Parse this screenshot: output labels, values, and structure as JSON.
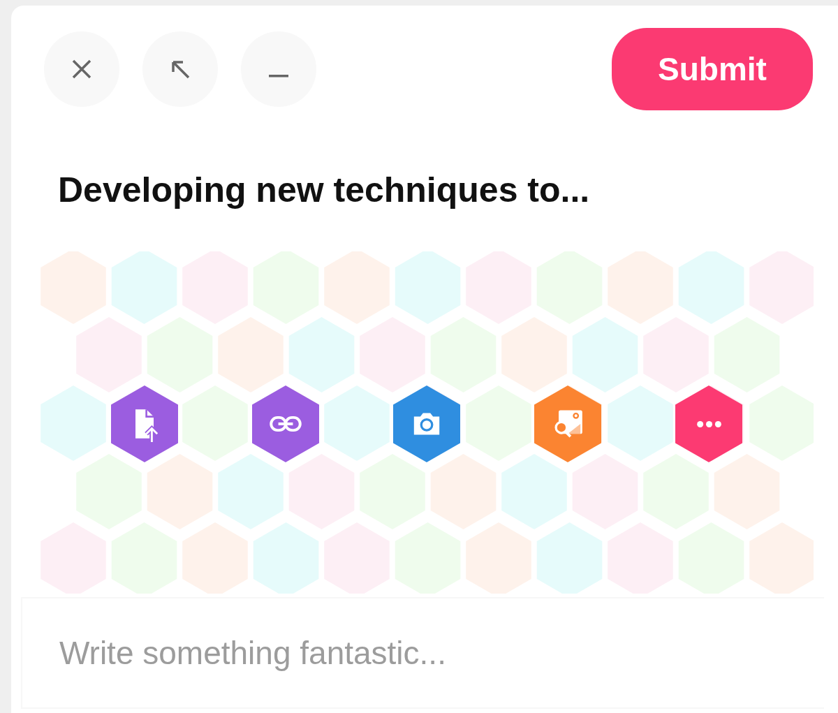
{
  "header": {
    "buttons": [
      {
        "kind": "close"
      },
      {
        "kind": "expand"
      },
      {
        "kind": "minimize"
      }
    ],
    "submit": "Submit"
  },
  "title": "Developing new techniques to...",
  "actions": [
    {
      "kind": "file-upload",
      "color": "#9b5de0"
    },
    {
      "kind": "link",
      "color": "#9b5de0"
    },
    {
      "kind": "camera",
      "color": "#2f8ee0"
    },
    {
      "kind": "image-search",
      "color": "#fb8431"
    },
    {
      "kind": "more",
      "color": "#fc3a72"
    }
  ],
  "composer": {
    "placeholder": "Write something fantastic..."
  }
}
